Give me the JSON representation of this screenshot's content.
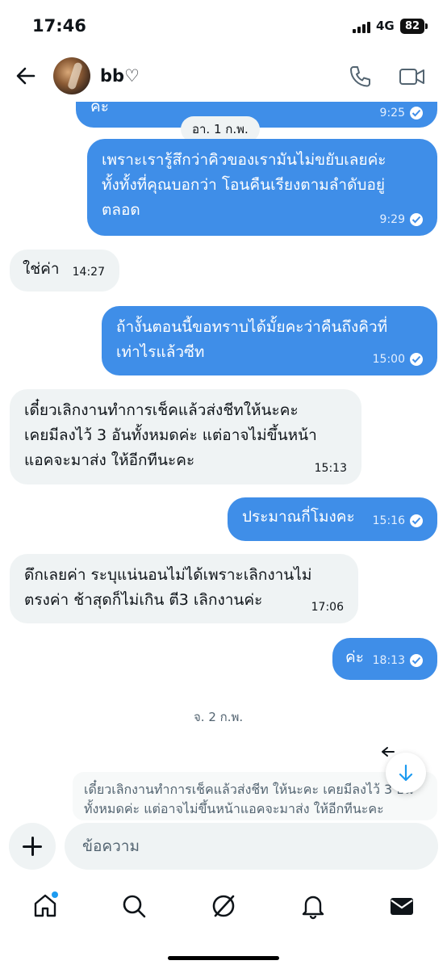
{
  "status_bar": {
    "time": "17:46",
    "network": "4G",
    "battery": "82"
  },
  "header": {
    "contact_name": "bb♡"
  },
  "messages": [
    {
      "type": "sent",
      "text": "ค่ะ",
      "time": "9:25"
    },
    {
      "type": "date",
      "text": "อา. 1 ก.พ."
    },
    {
      "type": "sent",
      "lines": [
        "เพราะเรารู้สึกว่าคิวของเรามันไม่ขยับเลยค่ะ",
        "ทั้งทั้งที่คุณบอกว่า โอนคืนเรียงตามลำดับอยู่",
        "ตลอด"
      ],
      "time": "9:29"
    },
    {
      "type": "received",
      "text": "ใช่ค่า",
      "time": "14:27"
    },
    {
      "type": "sent",
      "lines": [
        "ถ้างั้นตอนนี้ขอทราบได้มั้ยคะว่าคืนถึงคิวที่",
        "เท่าไรแล้วซีท"
      ],
      "time": "15:00"
    },
    {
      "type": "received",
      "lines": [
        "เดี๋ยวเลิกงานทำการเช็คแล้วส่งชีทให้นะคะ",
        "เคยมีลงไว้ 3 อันทั้งหมดค่ะ แต่อาจไม่ขึ้นหน้า",
        "แอคจะมาส่ง ให้อีกทีนะคะ"
      ],
      "time": "15:13"
    },
    {
      "type": "sent",
      "text": "ประมาณกี่โมงคะ",
      "time": "15:16"
    },
    {
      "type": "received",
      "lines": [
        "ดึกเลยค่า ระบุแน่นอนไม่ได้เพราะเลิกงานไม่",
        "ตรงค่า ช้าสุดก็ไม่เกิน ตี3 เลิกงานค่ะ"
      ],
      "time": "17:06"
    },
    {
      "type": "sent",
      "text": "ค่ะ",
      "time": "18:13"
    },
    {
      "type": "date",
      "text": "จ. 2 ก.พ."
    }
  ],
  "quoted_preview": {
    "lines": [
      "เดี๋ยวเลิกงานทำการเช็คแล้วส่งชีท ให้นะคะ เคยมีลงไว้ 3",
      "อันทั้งหมดค่ะ แต่อาจไม่ขึ้นหน้าแอคจะมาส่ง ให้อีกทีนะคะ"
    ]
  },
  "composer": {
    "placeholder": "ข้อความ"
  },
  "icons": {
    "back": "arrow-left-icon",
    "call": "phone-icon",
    "video": "video-camera-icon",
    "add": "plus-icon",
    "scroll": "arrow-down-icon",
    "read": "check-circle-icon",
    "tabs": [
      "home-icon",
      "search-icon",
      "grok-icon",
      "bell-icon",
      "envelope-icon"
    ]
  },
  "colors": {
    "sent_bubble": "#3f8ee8",
    "received_bubble": "#eff3f4",
    "accent": "#1d9bf0"
  }
}
